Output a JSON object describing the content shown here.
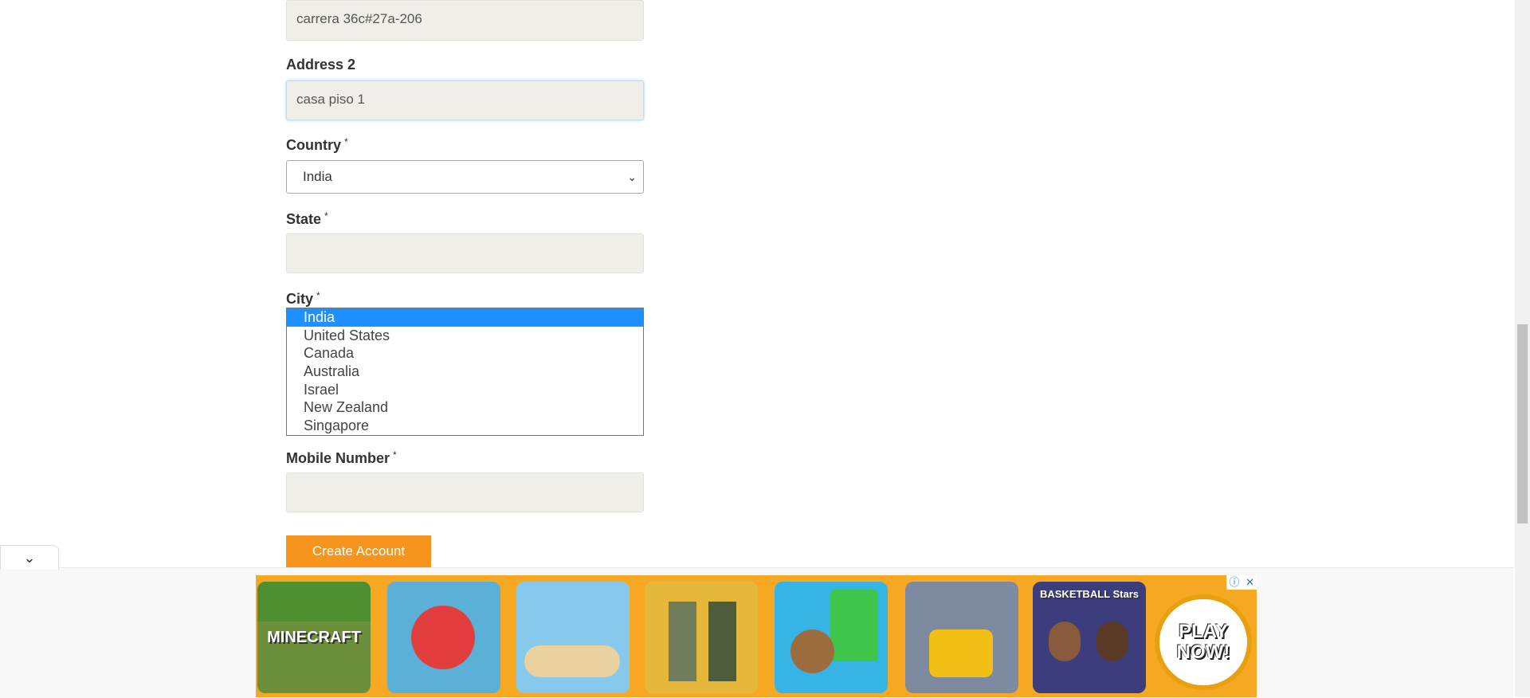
{
  "form": {
    "address1_value": "carrera 36c#27a-206",
    "address2_label": "Address 2",
    "address2_value": "casa piso 1",
    "country_label": "Country",
    "country_value": "India",
    "required_mark": "*",
    "state_label": "State",
    "city_label": "City",
    "mobile_label": "Mobile Number",
    "submit_label": "Create Account"
  },
  "country_dropdown": {
    "options": [
      "India",
      "United States",
      "Canada",
      "Australia",
      "Israel",
      "New Zealand",
      "Singapore"
    ],
    "selected": "India"
  },
  "ad": {
    "tiles": [
      "MINECRAFT",
      "",
      "",
      "",
      "",
      "",
      "BASKETBALL Stars",
      "PLAY NOW!"
    ],
    "info_icon": "ⓘ",
    "close_icon": "✕"
  },
  "colors": {
    "accent": "#f7941d",
    "highlight": "#1e90ff",
    "input_bg": "#efeee9",
    "ad_bg": "#f7a823"
  }
}
